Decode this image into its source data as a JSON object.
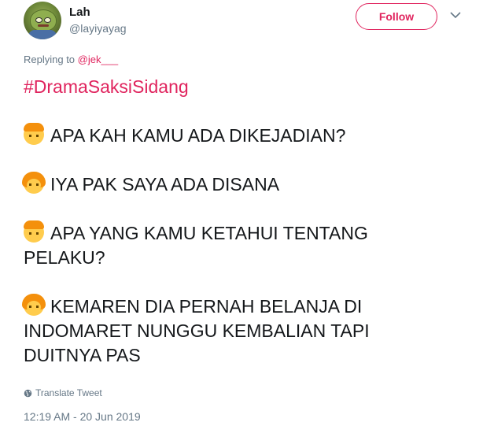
{
  "user": {
    "name": "Lah",
    "handle": "@layiyayag"
  },
  "actions": {
    "follow_label": "Follow"
  },
  "reply": {
    "prefix": "Replying to ",
    "mention": "@jek___"
  },
  "tweet": {
    "hashtag": "#DramaSaksiSidang",
    "paragraphs": [
      {
        "speaker": "boy",
        "lines": [
          "APA KAH KAMU ADA DIKEJADIAN?"
        ]
      },
      {
        "speaker": "girl",
        "lines": [
          "IYA PAK SAYA ADA DISANA"
        ]
      },
      {
        "speaker": "boy",
        "lines": [
          "APA YANG KAMU KETAHUI TENTANG",
          "PELAKU?"
        ]
      },
      {
        "speaker": "girl",
        "lines": [
          "KEMAREN DIA PERNAH BELANJA DI",
          "INDOMARET NUNGGU KEMBALIAN TAPI",
          "DUITNYA PAS"
        ]
      }
    ],
    "translate_label": "Translate Tweet",
    "timestamp": "12:19 AM - 20 Jun 2019"
  },
  "colors": {
    "accent": "#e0245e",
    "secondary_text": "#657786",
    "primary_text": "#14171a"
  },
  "icons": {
    "avatar": "frog-avatar",
    "more": "chevron-down-icon",
    "translate": "globe-icon",
    "boy_emoji": "boy-emoji-icon",
    "girl_emoji": "girl-emoji-icon"
  }
}
